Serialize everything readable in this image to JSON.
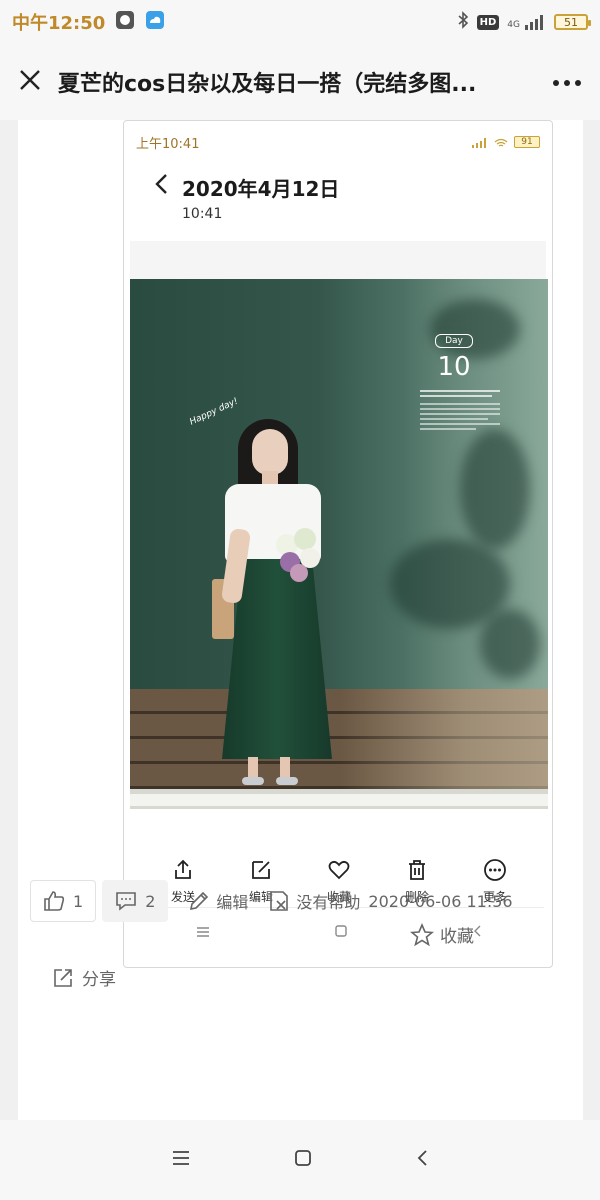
{
  "status_bar": {
    "time": "中午12:50",
    "hd": "HD",
    "net": "4G",
    "battery": "51"
  },
  "header": {
    "title": "夏芒的cos日杂以及每日一搭（完结多图..."
  },
  "screenshot": {
    "status_time": "上午10:41",
    "battery": "91",
    "title": "2020年4月12日",
    "subtitle": "10:41",
    "photo": {
      "day_label": "Day",
      "day_number": "10",
      "handwritten": "Happy day!"
    },
    "actions": [
      {
        "label": "发送",
        "icon": "share-icon"
      },
      {
        "label": "编辑",
        "icon": "edit-icon"
      },
      {
        "label": "收藏",
        "icon": "heart-icon"
      },
      {
        "label": "删除",
        "icon": "trash-icon"
      },
      {
        "label": "更多",
        "icon": "more-icon"
      }
    ]
  },
  "meta": {
    "likes": "1",
    "comments": "2",
    "edit_label": "编辑",
    "not_helpful_label": "没有帮助",
    "date": "2020-06-06 11:56",
    "favorite_label": "收藏",
    "share_label": "分享"
  },
  "colors": {
    "accent": "#c08a2a",
    "wall": "#35574b",
    "skirt": "#1f4a36"
  }
}
